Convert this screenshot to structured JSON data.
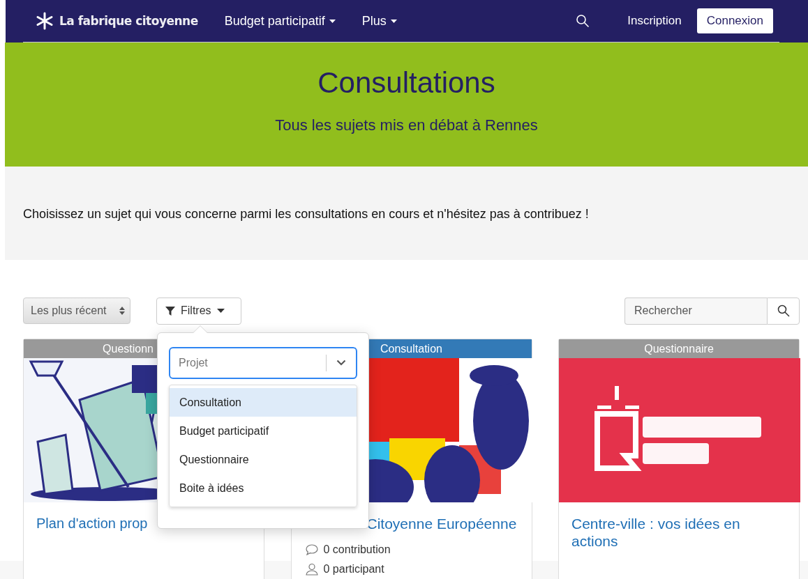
{
  "navbar": {
    "logo": "La fabrique citoyenne",
    "menu": [
      {
        "label": "Budget participatif",
        "dropdown": true
      },
      {
        "label": "Plus",
        "dropdown": true
      }
    ],
    "links": [
      "Inscription"
    ],
    "button": "Connexion"
  },
  "hero": {
    "title": "Consultations",
    "subtitle": "Tous les sujets mis en débat à Rennes"
  },
  "intro": "Choisissez un sujet qui vous concerne parmi les consultations en cours et n'hésitez pas à contribuez !",
  "toolbar": {
    "sort": "Les plus récent",
    "filter_button": "Filtres",
    "search": {
      "placeholder": "Rechercher"
    }
  },
  "filter_popover": {
    "select": {
      "placeholder": "Projet"
    },
    "options": [
      {
        "label": "Consultation",
        "selected": true
      },
      {
        "label": "Budget participatif",
        "selected": false
      },
      {
        "label": "Questionnaire",
        "selected": false
      },
      {
        "label": "Boite à idées",
        "selected": false
      }
    ]
  },
  "cards": [
    {
      "type": "Questionn",
      "color": "#999999",
      "title": "Plan d'action prop"
    },
    {
      "type": "Consultation",
      "color": "#337ab7",
      "title": "Citoyenne Européenne",
      "stats": [
        {
          "kind": "comment",
          "text": "0 contribution"
        },
        {
          "kind": "user",
          "text": "0 participant"
        }
      ]
    },
    {
      "type": "Questionnaire",
      "color": "#999999",
      "title": "Centre-ville : vos idées en actions"
    }
  ]
}
